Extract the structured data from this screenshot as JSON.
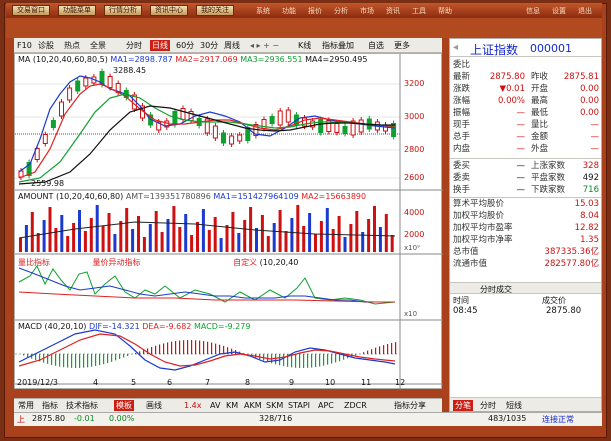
{
  "topbar": {
    "buttons": [
      "交易窗口",
      "功能菜单",
      "行情分析",
      "资讯中心",
      "我的关注"
    ],
    "menus": [
      "系统",
      "功能",
      "报价",
      "分析",
      "市场",
      "资讯",
      "工具",
      "帮助"
    ],
    "right": [
      "信息",
      "设置",
      "退出"
    ]
  },
  "toolbar": {
    "items": [
      "F10",
      "诊股",
      "热点",
      "全景",
      "分时",
      "日线",
      "60分",
      "30分",
      "周线",
      "K线",
      "指标叠加",
      "自选",
      "更多"
    ]
  },
  "main_chart": {
    "ma_legend": {
      "prefix": "MA",
      "params": "(10,20,40,60,80,5)",
      "ma1": "MA1=2898.787",
      "ma2": "MA2=2917.069",
      "ma3": "MA3=2936.551",
      "ma4": "MA4=2950.495"
    },
    "high_label": "3288.45",
    "low_label": "2559.98",
    "y_ticks": [
      "3200",
      "3000",
      "2800",
      "2600"
    ]
  },
  "volume": {
    "legend_name": "AMOUNT",
    "params": "(10,20,40,60,80)",
    "amt": "AMT=139351780896",
    "ma1": "MA1=151427964109",
    "ma2": "MA2=15663890",
    "y_ticks": [
      "4000",
      "2000",
      "x10⁹"
    ]
  },
  "indicator": {
    "left_label": "量比指标",
    "mid_label": "量价异动指标",
    "right_label": "自定义",
    "params": "(10,20,40",
    "y_ticks": [
      "x10"
    ]
  },
  "macd": {
    "legend_name": "MACD",
    "params": "(40,20,10)",
    "dif": "DIF=-14.321",
    "dea": "DEA=-9.682",
    "macd": "MACD=-9.279"
  },
  "x_axis": {
    "labels": [
      "2019/12/3",
      "4",
      "5",
      "6",
      "7",
      "8",
      "9",
      "10",
      "11",
      "12"
    ]
  },
  "bottom_tabs": [
    "常用",
    "指标",
    "技术指标",
    "模板",
    "画线",
    "1.4x",
    "AV",
    "KM",
    "AKM",
    "SKM",
    "STAPI",
    "APC",
    "ZDCR",
    "指标分享"
  ],
  "quote": {
    "name": "上证指数",
    "code": "000001",
    "rows": [
      {
        "k1": "委比",
        "v1": "",
        "k2": "",
        "v2": ""
      },
      {
        "k1": "最新",
        "v1": "2875.80",
        "k2": "昨收",
        "v2": "2875.81"
      },
      {
        "k1": "涨跌",
        "v1": "▼0.01",
        "k2": "开盘",
        "v2": "0.00"
      },
      {
        "k1": "涨幅",
        "v1": "0.00%",
        "k2": "最高",
        "v2": "0.00"
      },
      {
        "k1": "振幅",
        "v1": "—",
        "k2": "最低",
        "v2": "0.00"
      },
      {
        "k1": "现手",
        "v1": "—",
        "k2": "量比",
        "v2": "—"
      },
      {
        "k1": "总手",
        "v1": "—",
        "k2": "金额",
        "v2": "—"
      },
      {
        "k1": "内盘",
        "v1": "—",
        "k2": "外盘",
        "v2": "—"
      }
    ],
    "breadth": [
      {
        "k1": "委买",
        "v1": "—",
        "k2": "上涨家数",
        "v2": "328"
      },
      {
        "k1": "委卖",
        "v1": "—",
        "k2": "平盘家数",
        "v2": "492"
      },
      {
        "k1": "换手",
        "v1": "—",
        "k2": "下跌家数",
        "v2": "716"
      }
    ],
    "stats": [
      {
        "k": "算术平均股价",
        "v": "15.03"
      },
      {
        "k": "加权平均股价",
        "v": "8.04"
      },
      {
        "k": "加权平均市盈率",
        "v": "12.82"
      },
      {
        "k": "加权平均市净率",
        "v": "1.35"
      },
      {
        "k": "总市值",
        "v": "387335.36亿"
      },
      {
        "k": "流通市值",
        "v": "282577.80亿"
      }
    ],
    "tick_header": "分时成交",
    "tick_cols": [
      "时间",
      "成交价"
    ],
    "ticks": [
      {
        "t": "08:45",
        "p": "2875.80"
      }
    ],
    "side_tabs": [
      "分笔",
      "分时",
      "短线"
    ]
  },
  "status": {
    "left": "上",
    "index_value": "2875.80",
    "change": "-0.01",
    "pct": "0.00%",
    "count": "328/716",
    "amount": "483/1035",
    "conn": "连接正常"
  },
  "colors": {
    "up": "#d01010",
    "down": "#0a8a22",
    "frame": "#a8411c",
    "ma_red": "#e02020",
    "ma_blue": "#1a3ad0",
    "ma_green": "#10a030",
    "ma_black": "#101010"
  }
}
